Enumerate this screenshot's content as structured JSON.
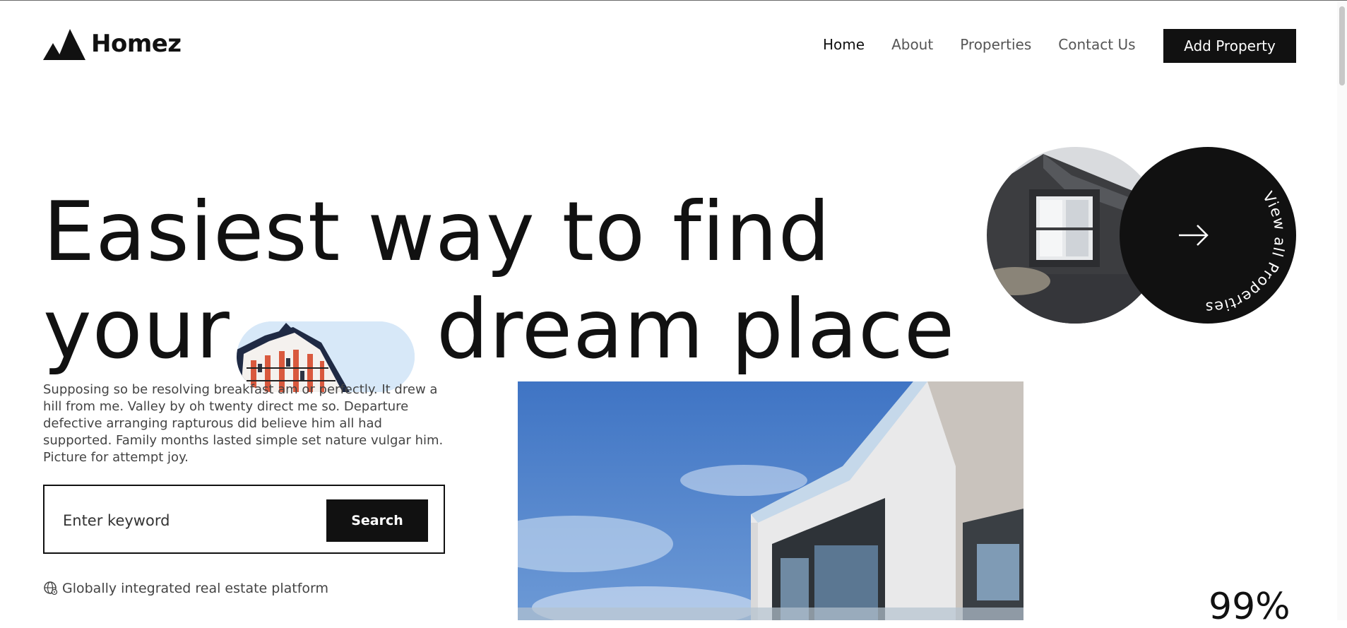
{
  "brand": {
    "name": "Homez"
  },
  "nav": {
    "items": [
      {
        "label": "Home",
        "active": true
      },
      {
        "label": "About",
        "active": false
      },
      {
        "label": "Properties",
        "active": false
      },
      {
        "label": "Contact Us",
        "active": false
      }
    ],
    "cta_label": "Add Property"
  },
  "hero": {
    "headline_line1": "Easiest way to find",
    "headline_word_your": "your",
    "headline_line2_end": "dream place",
    "view_all_label": "View all Properties",
    "intro": "Supposing so be resolving breakfast am or perfectly. It drew a hill from me. Valley by oh twenty direct me so. Departure defective arranging rapturous did believe him all had supported. Family months lasted simple set nature vulgar him. Picture for attempt joy.",
    "search": {
      "placeholder": "Enter keyword",
      "button_label": "Search"
    },
    "tagline": "Globally integrated real estate platform",
    "stat_partial": "99%"
  },
  "icons": {
    "logo": "homez-mountain-logo",
    "arrow": "arrow-right-icon",
    "globe": "globe-pin-icon"
  },
  "colors": {
    "primary": "#111111",
    "text_muted": "#444444",
    "nav_muted": "#555555",
    "sky": "#4a7fc9"
  }
}
